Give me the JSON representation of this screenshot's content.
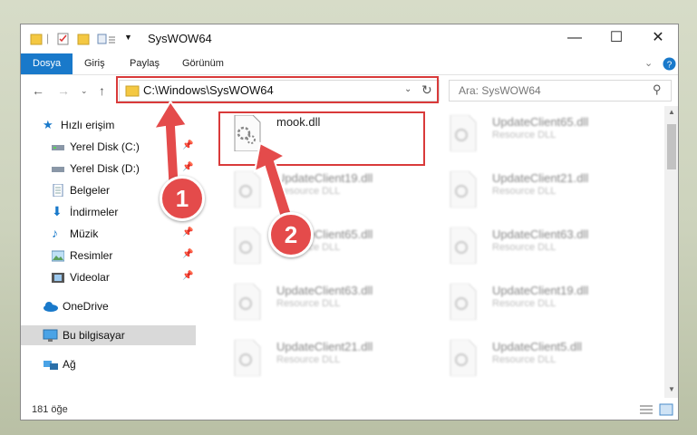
{
  "window": {
    "title": "SysWOW64",
    "controls": {
      "minimize": "—",
      "maximize": "☐",
      "close": "✕"
    }
  },
  "ribbon": {
    "tabs": [
      {
        "label": "Dosya",
        "active": true
      },
      {
        "label": "Giriş",
        "active": false
      },
      {
        "label": "Paylaş",
        "active": false
      },
      {
        "label": "Görünüm",
        "active": false
      }
    ]
  },
  "nav": {
    "address": "C:\\Windows\\SysWOW64",
    "search_placeholder": "Ara: SysWOW64"
  },
  "sidebar": {
    "items": [
      {
        "label": "Hızlı erişim",
        "icon": "star-icon",
        "pinned": false
      },
      {
        "label": "Yerel Disk (C:)",
        "icon": "drive-icon",
        "pinned": true
      },
      {
        "label": "Yerel Disk (D:)",
        "icon": "drive-icon",
        "pinned": true
      },
      {
        "label": "Belgeler",
        "icon": "documents-icon",
        "pinned": true
      },
      {
        "label": "İndirmeler",
        "icon": "download-icon",
        "pinned": true
      },
      {
        "label": "Müzik",
        "icon": "music-icon",
        "pinned": true
      },
      {
        "label": "Resimler",
        "icon": "pictures-icon",
        "pinned": true
      },
      {
        "label": "Videolar",
        "icon": "videos-icon",
        "pinned": true
      },
      {
        "label": "OneDrive",
        "icon": "cloud-icon",
        "pinned": false
      },
      {
        "label": "Bu bilgisayar",
        "icon": "computer-icon",
        "pinned": false,
        "selected": true
      },
      {
        "label": "Ağ",
        "icon": "network-icon",
        "pinned": false
      }
    ]
  },
  "files": [
    {
      "name": "mook.dll",
      "type": "",
      "highlighted": true
    },
    {
      "name": "UpdateClient65.dll",
      "type": "Resource DLL"
    },
    {
      "name": "UpdateClient19.dll",
      "type": "Resource DLL"
    },
    {
      "name": "UpdateClient21.dll",
      "type": "Resource DLL"
    },
    {
      "name": "UpdateClient65.dll",
      "type": "Resource DLL"
    },
    {
      "name": "UpdateClient63.dll",
      "type": "Resource DLL"
    },
    {
      "name": "UpdateClient63.dll",
      "type": "Resource DLL"
    },
    {
      "name": "UpdateClient19.dll",
      "type": "Resource DLL"
    },
    {
      "name": "UpdateClient21.dll",
      "type": "Resource DLL"
    },
    {
      "name": "UpdateClient5.dll",
      "type": "Resource DLL"
    }
  ],
  "status": {
    "count": "181 öğe"
  },
  "annotations": {
    "step1": "1",
    "step2": "2"
  },
  "colors": {
    "accent": "#1979ca",
    "annotation": "#e44b4b",
    "selected": "#d9d9d9"
  }
}
